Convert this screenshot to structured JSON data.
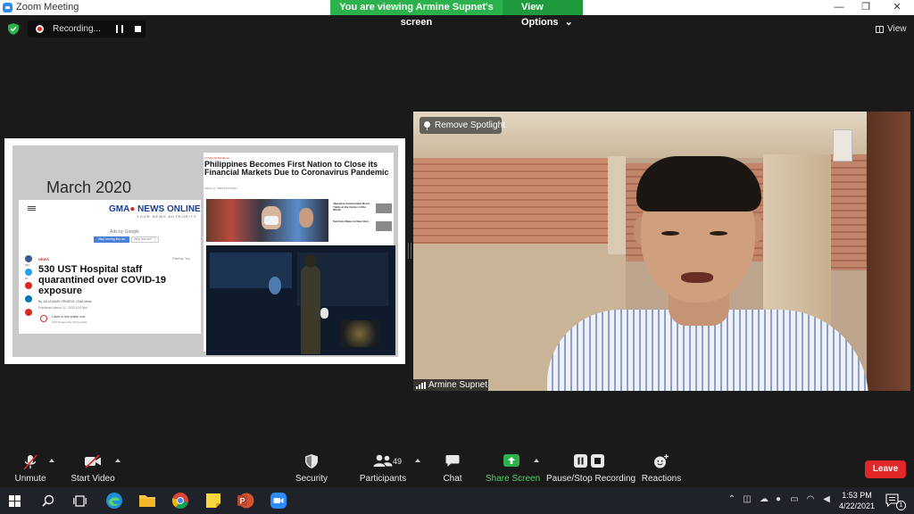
{
  "window": {
    "title": "Zoom Meeting",
    "minimize": "—",
    "restore": "❐",
    "close": "✕"
  },
  "banner": {
    "viewing_text": "You are viewing Armine Supnet's screen",
    "view_options": "View Options",
    "caret": "⌄"
  },
  "recording": {
    "label": "Recording..."
  },
  "view_button": {
    "label": "View"
  },
  "shared_screen": {
    "slide_title": "March 2020",
    "left_article": {
      "logo_gma": "GMA",
      "logo_news": "NEWS ONLINE",
      "tagline": "YOUR NEWS AUTHORITY",
      "ads_by": "Ads by Google",
      "ads_button": "Stop seeing this ad",
      "ads_why": "Why this ad? ⓘ",
      "share_labels": [
        "640",
        "16",
        "",
        "",
        "0"
      ],
      "section": "NEWS",
      "filed": "Filed by: You",
      "headline": "530 UST Hospital staff quarantined over COVID-19 exposure",
      "byline": "By JULIA MARI ORNEDO, GMA News",
      "published": "Published March 21, 2020 10:57pm",
      "listen": "Listen to this article now",
      "listen_time": "0:00    Powered by Trinity Audio"
    },
    "right_article": {
      "kicker": "COVID-19 Pandemic",
      "headline": "Philippines Becomes First Nation to Close its Financial Markets Due to Coronavirus Pandemic",
      "date": "March 17, 2020 8:33 AM ET",
      "side_items": [
        "Japanese Government Bond Yields at the Center of the World",
        "Fed Cuts Rates to Near Zero"
      ]
    }
  },
  "video": {
    "remove_spotlight": "Remove Spotlight",
    "participant_name": "Armine Supnet"
  },
  "toolbar": {
    "unmute": "Unmute",
    "start_video": "Start Video",
    "security": "Security",
    "participants": "Participants",
    "participants_count": "49",
    "chat": "Chat",
    "share_screen": "Share Screen",
    "pause_stop_recording": "Pause/Stop Recording",
    "reactions": "Reactions",
    "leave": "Leave"
  },
  "taskbar": {
    "time": "1:53 PM",
    "date": "4/22/2021",
    "notification_count": "1"
  },
  "colors": {
    "banner_green": "#2bb24c",
    "share_green": "#2bb24c",
    "leave_red": "#e02828",
    "zoom_blue": "#2d8cff"
  }
}
